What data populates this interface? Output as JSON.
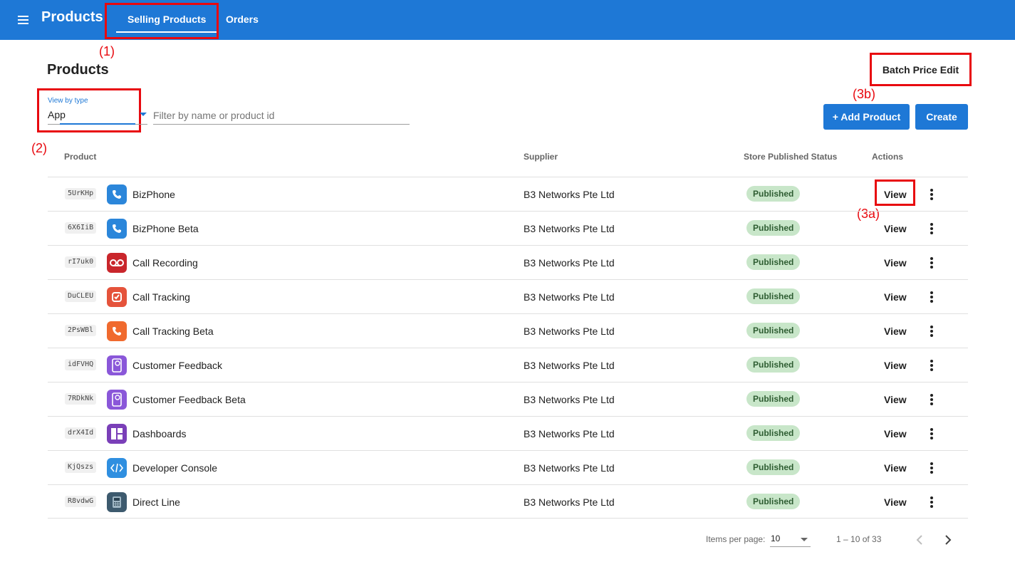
{
  "header": {
    "app_title": "Products",
    "tabs": [
      {
        "label": "Selling Products",
        "active": true
      },
      {
        "label": "Orders",
        "active": false
      }
    ],
    "accent_color": "#1e78d6"
  },
  "annotations": [
    "(1)",
    "(2)",
    "(3a)",
    "(3b)"
  ],
  "page": {
    "title": "Products",
    "batch_price_edit_label": "Batch Price Edit",
    "add_product_label": "+ Add Product",
    "create_label": "Create"
  },
  "filters": {
    "view_by_type_label": "View by type",
    "view_by_type_value": "App",
    "search_placeholder": "Filter by name or product id"
  },
  "table": {
    "headers": {
      "product": "Product",
      "supplier": "Supplier",
      "status": "Store Published Status",
      "actions": "Actions"
    },
    "rows": [
      {
        "id": "5UrKHp",
        "name": "BizPhone",
        "supplier": "B3 Networks Pte Ltd",
        "status": "Published",
        "action": "View",
        "icon": "bizphone-icon"
      },
      {
        "id": "6X6IiB",
        "name": "BizPhone Beta",
        "supplier": "B3 Networks Pte Ltd",
        "status": "Published",
        "action": "View",
        "icon": "bizphone-icon"
      },
      {
        "id": "rI7uk0",
        "name": "Call Recording",
        "supplier": "B3 Networks Pte Ltd",
        "status": "Published",
        "action": "View",
        "icon": "call-recording-icon"
      },
      {
        "id": "DuCLEU",
        "name": "Call Tracking",
        "supplier": "B3 Networks Pte Ltd",
        "status": "Published",
        "action": "View",
        "icon": "call-tracking-icon"
      },
      {
        "id": "2PsWBl",
        "name": "Call Tracking Beta",
        "supplier": "B3 Networks Pte Ltd",
        "status": "Published",
        "action": "View",
        "icon": "call-tracking-beta-icon"
      },
      {
        "id": "idFVHQ",
        "name": "Customer Feedback",
        "supplier": "B3 Networks Pte Ltd",
        "status": "Published",
        "action": "View",
        "icon": "customer-feedback-icon"
      },
      {
        "id": "7RDkNk",
        "name": "Customer Feedback Beta",
        "supplier": "B3 Networks Pte Ltd",
        "status": "Published",
        "action": "View",
        "icon": "customer-feedback-icon"
      },
      {
        "id": "drX4Id",
        "name": "Dashboards",
        "supplier": "B3 Networks Pte Ltd",
        "status": "Published",
        "action": "View",
        "icon": "dashboards-icon"
      },
      {
        "id": "KjQszs",
        "name": "Developer Console",
        "supplier": "B3 Networks Pte Ltd",
        "status": "Published",
        "action": "View",
        "icon": "developer-console-icon"
      },
      {
        "id": "R8vdwG",
        "name": "Direct Line",
        "supplier": "B3 Networks Pte Ltd",
        "status": "Published",
        "action": "View",
        "icon": "direct-line-icon"
      }
    ]
  },
  "paginator": {
    "items_per_page_label": "Items per page:",
    "page_size": "10",
    "range_label": "1 – 10 of 33"
  }
}
